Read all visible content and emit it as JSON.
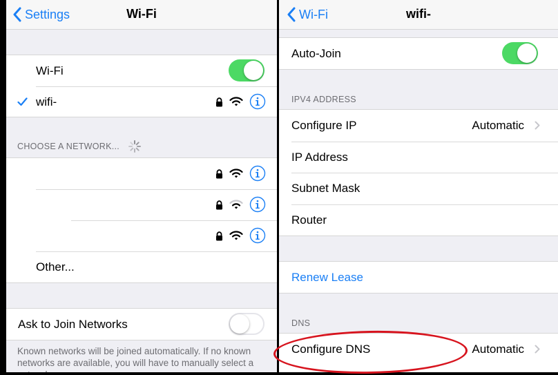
{
  "left": {
    "navbar": {
      "back_label": "Settings",
      "title": "Wi-Fi"
    },
    "wifi_toggle": {
      "label": "Wi-Fi",
      "state": "on"
    },
    "connected_network": {
      "name": "wifi-"
    },
    "choose_header": "CHOOSE A NETWORK...",
    "networks": [
      {
        "name": "",
        "locked": true,
        "signal": "full"
      },
      {
        "name": "",
        "locked": true,
        "signal": "medium"
      },
      {
        "name": "",
        "locked": true,
        "signal": "full"
      }
    ],
    "other_label": "Other...",
    "ask_to_join": {
      "label": "Ask to Join Networks",
      "state": "off"
    },
    "footer": "Known networks will be joined automatically. If no known networks are available, you will have to manually select a network."
  },
  "right": {
    "navbar": {
      "back_label": "Wi-Fi",
      "title": "wifi-"
    },
    "auto_join": {
      "label": "Auto-Join",
      "state": "on"
    },
    "ipv4_header": "IPV4 ADDRESS",
    "ipv4_rows": {
      "configure_ip": {
        "label": "Configure IP",
        "value": "Automatic"
      },
      "ip_address": {
        "label": "IP Address",
        "value": ""
      },
      "subnet_mask": {
        "label": "Subnet Mask",
        "value": ""
      },
      "router": {
        "label": "Router",
        "value": ""
      }
    },
    "renew_lease": "Renew Lease",
    "dns_header": "DNS",
    "configure_dns": {
      "label": "Configure DNS",
      "value": "Automatic"
    }
  },
  "colors": {
    "accent": "#1a7ff5",
    "toggle_on": "#4cd964",
    "highlight": "#d7141e",
    "group_background": "#efeff4"
  },
  "icons": {
    "back": "chevron-left-icon",
    "checkmark": "checkmark-icon",
    "lock": "lock-icon",
    "wifi": "wifi-signal-icon",
    "info": "info-icon",
    "disclosure": "chevron-right-icon",
    "spinner": "spinner-icon"
  }
}
